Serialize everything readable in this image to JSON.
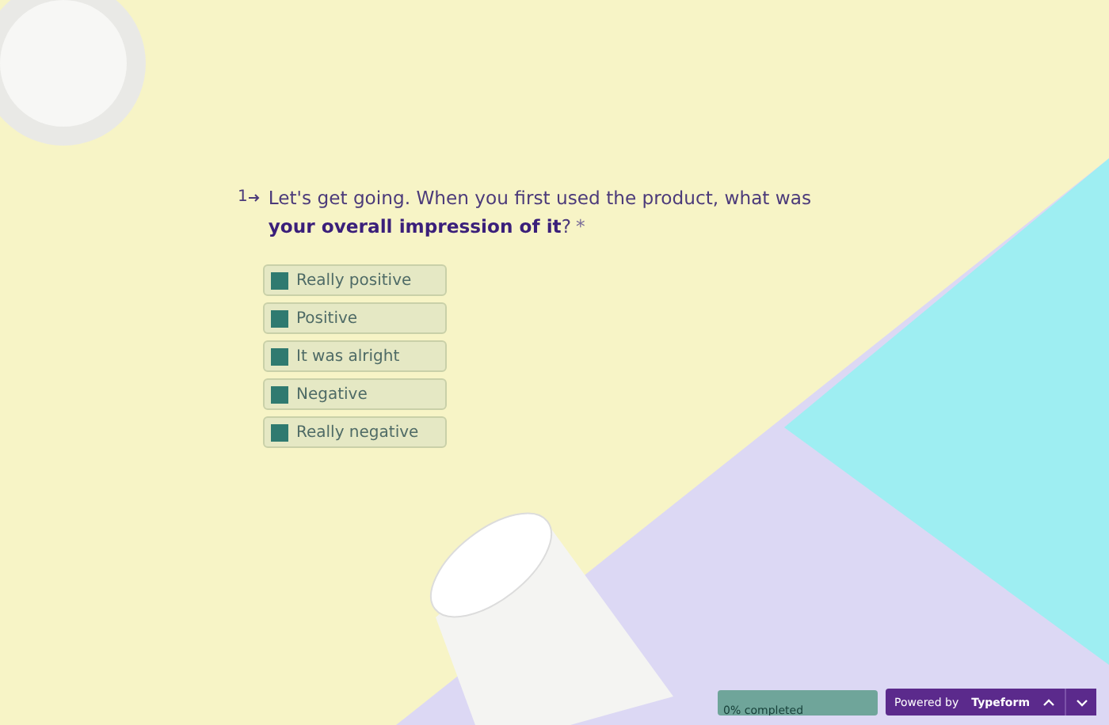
{
  "question": {
    "number": "1",
    "text": "Let's get going. When you first used the product, what was **your overall impression of it**?",
    "required_mark": "*"
  },
  "options": [
    {
      "label": "Really positive"
    },
    {
      "label": "Positive"
    },
    {
      "label": "It was alright"
    },
    {
      "label": "Negative"
    },
    {
      "label": "Really negative"
    }
  ],
  "footer": {
    "progress": {
      "text": "0% completed",
      "level": 0
    },
    "branding": "Powered by **Typeform**"
  }
}
